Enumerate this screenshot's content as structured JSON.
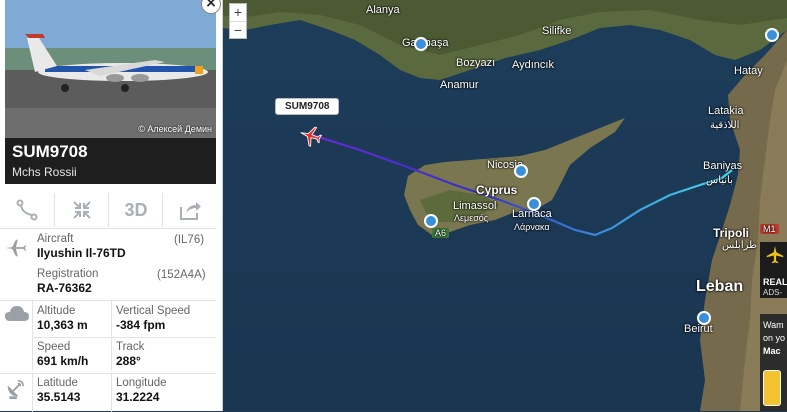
{
  "flight": {
    "callsign": "SUM9708",
    "airline": "Mchs Rossii",
    "photo_credit": "© Алексей Демин",
    "close": "×"
  },
  "toolbar": {
    "route_icon": "route-icon",
    "expand_icon": "compress-icon",
    "view_3d": "3D",
    "share_icon": "share-icon"
  },
  "details": {
    "aircraft": {
      "label": "Aircraft",
      "value": "Ilyushin Il-76TD",
      "code": "(IL76)"
    },
    "registration": {
      "label": "Registration",
      "value": "RA-76362",
      "code": "(152A4A)"
    },
    "altitude": {
      "label": "Altitude",
      "value": "10,363 m"
    },
    "vertical_speed": {
      "label": "Vertical Speed",
      "value": "-384 fpm"
    },
    "speed": {
      "label": "Speed",
      "value": "691 km/h"
    },
    "track": {
      "label": "Track",
      "value": "288°"
    },
    "latitude": {
      "label": "Latitude",
      "value": "35.5143"
    },
    "longitude": {
      "label": "Longitude",
      "value": "31.2224"
    }
  },
  "map": {
    "zoom_in": "+",
    "zoom_out": "−",
    "flight_tag": "SUM9708",
    "labels": {
      "alanya": "Alanya",
      "silifke": "Silifke",
      "gazipasa": "Gazipaşa",
      "bozyazi": "Bozyazı",
      "aydincik": "Aydıncık",
      "anamur": "Anamur",
      "nicosia": "Nicosia",
      "cyprus": "Cyprus",
      "limassol": "Limassol",
      "limassol_gr": "Λεμεσός",
      "larnaca": "Larnaca",
      "larnaca_gr": "Λάρνακα",
      "latakia": "Latakia",
      "latakia_ar": "اللاذقية",
      "baniyas": "Baniyas",
      "baniyas_ar": "بانياس",
      "hatay": "Hatay",
      "tripoli": "Tripoli",
      "tripoli_ar": "طرابلس",
      "lebanon": "Leban",
      "beirut": "Beirut",
      "a6": "A6",
      "m1": "M1",
      "realtime": "REAL",
      "adsb": "ADS-",
      "warn1": "Wam",
      "warn2": "on yo",
      "warn3": "Mac"
    }
  },
  "colors": {
    "accent_dark": "#1e1e1e",
    "track_start": "#44ddee",
    "track_end": "#5533dd",
    "aircraft": "#e0302a"
  }
}
